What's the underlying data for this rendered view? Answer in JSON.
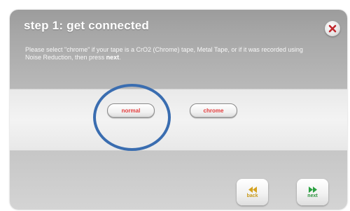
{
  "dialog": {
    "title": "step 1: get connected",
    "instructions": {
      "text": "Please select \"chrome\" if your tape is a CrO2 (Chrome) tape, Metal Tape, or if it was recorded using Noise Reduction, then press ",
      "emphasis": "next",
      "end": "."
    },
    "close_icon": "close-x-icon"
  },
  "options": {
    "normal": "normal",
    "chrome": "chrome",
    "selected": "normal"
  },
  "nav": {
    "back": "back",
    "next": "next",
    "back_icon": "rewind-icon",
    "next_icon": "fast-forward-icon"
  },
  "colors": {
    "option_text": "#e23a3a",
    "highlight_ring": "#3a6db0",
    "back_icon": "#d4a21f",
    "next_icon": "#2aa040"
  }
}
